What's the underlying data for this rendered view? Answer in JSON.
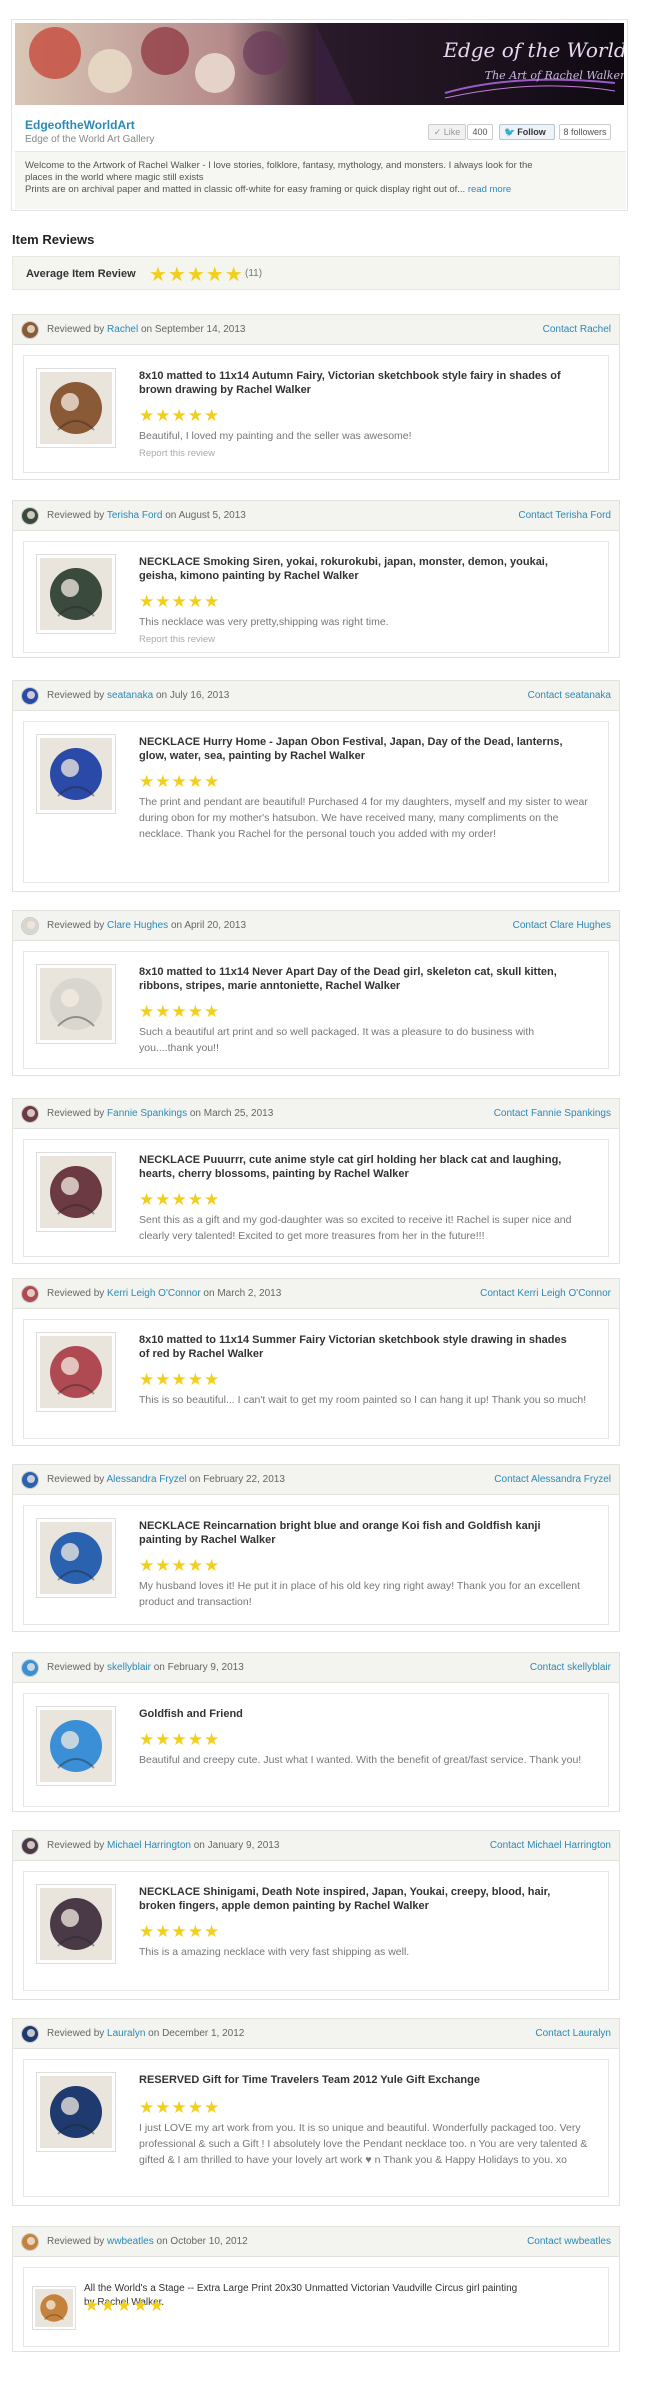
{
  "shop": {
    "name": "EdgeoftheWorldArt",
    "subtitle": "Edge of the World Art Gallery",
    "banner_title": "Edge of the World",
    "banner_subtitle": "The Art of Rachel Walker",
    "like_label": "Like",
    "like_count": "400",
    "follow_label": "Follow",
    "followers_label": "8 followers",
    "welcome_line1": "Welcome to the Artwork of Rachel Walker - I love stories, folklore, fantasy, mythology, and monsters. I always look for the",
    "welcome_line2": "places in the world where magic still exists",
    "welcome_line3": "Prints are on archival paper and matted in classic off-white for easy framing or quick display right out of...",
    "read_more": "read more"
  },
  "reviews_section": {
    "title": "Item Reviews",
    "average_label": "Average Item Review",
    "average_stars": "★★★★★",
    "count": "(11)"
  },
  "reviews": [
    {
      "reviewer": "Rachel",
      "date": "September 14, 2013",
      "contact": "Contact Rachel",
      "title": "8x10 matted to 11x14 Autumn Fairy, Victorian sketchbook style fairy in shades of brown drawing by Rachel Walker",
      "stars": "★★★★★",
      "text": "Beautiful, I loved my painting and the seller was awesome!",
      "report": "Report this review",
      "thumb_color": "#8a5a36"
    },
    {
      "reviewer": "Terisha Ford",
      "date": "August 5, 2013",
      "contact": "Contact Terisha Ford",
      "title": "NECKLACE Smoking Siren, yokai, rokurokubi, japan, monster, demon, youkai, geisha, kimono painting by Rachel Walker",
      "stars": "★★★★★",
      "text": "This necklace was very pretty,shipping was right time.",
      "report": "Report this review",
      "thumb_color": "#3a4a3c"
    },
    {
      "reviewer": "seatanaka",
      "date": "July 16, 2013",
      "contact": "Contact seatanaka",
      "title": "NECKLACE Hurry Home - Japan Obon Festival, Japan, Day of the Dead, lanterns, glow, water, sea, painting by Rachel Walker",
      "stars": "★★★★★",
      "text": "The print and pendant are beautiful! Purchased 4 for my daughters, myself and my sister to wear during obon for my mother's hatsubon. We have received many, many compliments on the necklace. Thank you Rachel for the personal touch you added with my order!",
      "report": "",
      "thumb_color": "#2b4aa8"
    },
    {
      "reviewer": "Clare Hughes",
      "date": "April 20, 2013",
      "contact": "Contact Clare Hughes",
      "title": "8x10 matted to 11x14 Never Apart Day of the Dead girl, skeleton cat, skull kitten, ribbons, stripes, marie anntoniette, Rachel Walker",
      "stars": "★★★★★",
      "text": "Such a beautiful art print and so well packaged. It was a pleasure to do business with you....thank you!!",
      "report": "",
      "thumb_color": "#d9d6d0"
    },
    {
      "reviewer": "Fannie Spankings",
      "date": "March 25, 2013",
      "contact": "Contact Fannie Spankings",
      "title": "NECKLACE Puuurrr, cute anime style cat girl holding her black cat and laughing, hearts, cherry blossoms, painting by Rachel Walker",
      "stars": "★★★★★",
      "text": "Sent this as a gift and my god-daughter was so excited to receive it! Rachel is super nice and clearly very talented! Excited to get more treasures from her in the future!!!",
      "report": "",
      "thumb_color": "#6b3a42"
    },
    {
      "reviewer": "Kerri Leigh O'Connor",
      "date": "March 2, 2013",
      "contact": "Contact Kerri Leigh O'Connor",
      "title": "8x10 matted to 11x14 Summer Fairy Victorian sketchbook style drawing in shades of red by Rachel Walker",
      "stars": "★★★★★",
      "text": "This is so beautiful... I can't wait to get my room painted so I can hang it up! Thank you so much!",
      "report": "",
      "thumb_color": "#b04a52"
    },
    {
      "reviewer": "Alessandra Fryzel",
      "date": "February 22, 2013",
      "contact": "Contact Alessandra Fryzel",
      "title": "NECKLACE Reincarnation bright blue and orange Koi fish and Goldfish kanji painting by Rachel Walker",
      "stars": "★★★★★",
      "text": "My husband loves it! He put it in place of his old key ring right away! Thank you for an excellent product and transaction!",
      "report": "",
      "thumb_color": "#2a62b0"
    },
    {
      "reviewer": "skellyblair",
      "date": "February 9, 2013",
      "contact": "Contact skellyblair",
      "title": "Goldfish and Friend",
      "stars": "★★★★★",
      "text": "Beautiful and creepy cute. Just what I wanted. With the benefit of great/fast service. Thank you!",
      "report": "",
      "thumb_color": "#3a8fd6"
    },
    {
      "reviewer": "Michael Harrington",
      "date": "January 9, 2013",
      "contact": "Contact Michael Harrington",
      "title": "NECKLACE Shinigami, Death Note inspired, Japan, Youkai, creepy, blood, hair, broken fingers, apple demon painting by Rachel Walker",
      "stars": "★★★★★",
      "text": "This is a amazing necklace with very fast shipping as well.",
      "report": "",
      "thumb_color": "#4a3a48"
    },
    {
      "reviewer": "Lauralyn",
      "date": "December 1, 2012",
      "contact": "Contact Lauralyn",
      "title": "RESERVED Gift for Time Travelers Team 2012 Yule Gift Exchange",
      "stars": "★★★★★",
      "text": "I just LOVE my art work from you. It is so unique and beautiful. Wonderfully packaged too. Very professional & such a Gift ! I absolutely love the Pendant necklace too. n You are very talented & gifted & I am thrilled to have your lovely art work ♥ n Thank you & Happy Holidays to you. xo",
      "report": "",
      "thumb_color": "#1f3a6e"
    },
    {
      "reviewer": "wwbeatles",
      "date": "October 10, 2012",
      "contact": "Contact wwbeatles",
      "title": "All the World's a Stage -- Extra Large Print 20x30 Unmatted Victorian Vaudville Circus girl painting by Rachel Walker.",
      "stars": "★★★★★",
      "text": "",
      "report": "",
      "thumb_color": "#c4823c"
    }
  ],
  "colors": {
    "link": "#2a8ab7",
    "star": "#f2cf1b",
    "header_bg": "#f3f3ef"
  }
}
